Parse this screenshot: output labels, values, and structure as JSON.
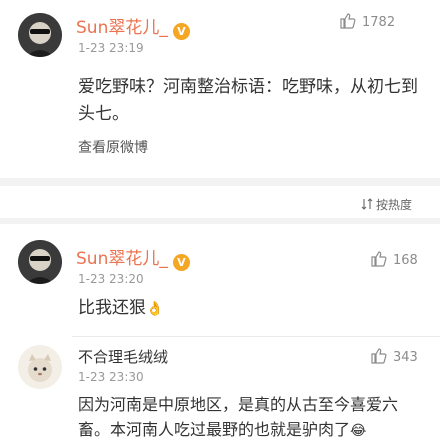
{
  "post": {
    "author": "Sun翠花儿_",
    "time": "1-23 23:19",
    "likes": "1782",
    "text": "爱吃野味？河南整治标语：吃野味，从初七到头七。",
    "view_original": "查看原微博"
  },
  "sort": {
    "label": "按热度"
  },
  "comments": [
    {
      "author": "Sun翠花儿_",
      "time": "1-23 23:20",
      "likes": "168",
      "text": "比我还狠",
      "emoji": "👌"
    },
    {
      "author": "不合理毛绒绒",
      "time": "1-23 23:30",
      "likes": "343",
      "text": "因为河南是中原地区，是真的从古至今喜爱六畜。本河南人吃过最野的也就是驴肉了",
      "emoji": "😂"
    }
  ],
  "colors": {
    "username": "#eb7350",
    "vip": "#f5a623",
    "divider": "#f2f2f2"
  }
}
